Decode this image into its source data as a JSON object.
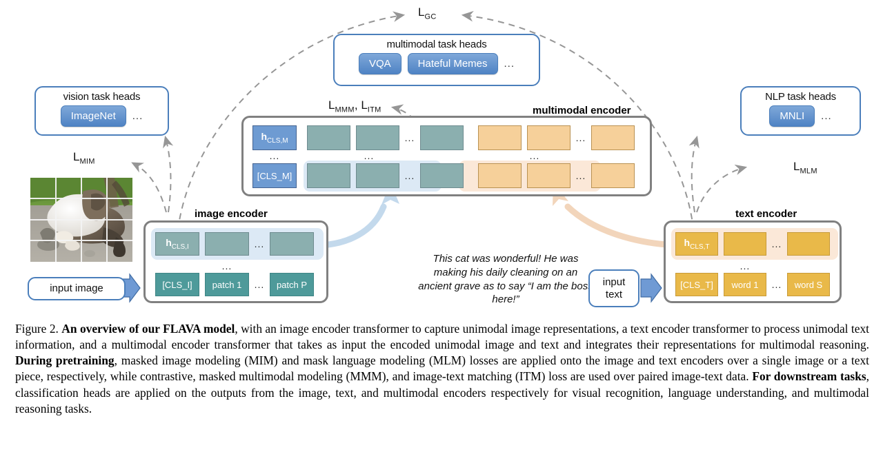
{
  "figure": {
    "losses": {
      "global_contrastive": "L",
      "global_contrastive_sub": "GC",
      "mim": "L",
      "mim_sub": "MIM",
      "mlm": "L",
      "mlm_sub": "MLM",
      "mmm_itm": "L",
      "mmm_itm_sub": "MMM",
      "mmm_itm_2": "L",
      "mmm_itm_2_sub": "ITM",
      "mmm_itm_separator": ", "
    },
    "vision_task_heads": {
      "title": "vision task heads",
      "items": [
        "ImageNet"
      ],
      "ellipsis": "..."
    },
    "multimodal_task_heads": {
      "title": "multimodal task heads",
      "items": [
        "VQA",
        "Hateful Memes"
      ],
      "ellipsis": "..."
    },
    "nlp_task_heads": {
      "title": "NLP task heads",
      "items": [
        "MNLI"
      ],
      "ellipsis": "..."
    },
    "multimodal_encoder": {
      "label": "multimodal encoder",
      "hidden_row": {
        "cls": "h",
        "cls_sub": "CLS,M",
        "image_tokens": [
          "",
          "",
          ""
        ],
        "image_ellipsis": "...",
        "text_tokens": [
          "",
          "",
          ""
        ],
        "text_ellipsis": "..."
      },
      "vertical_ellipsis": "...",
      "input_row": {
        "cls": "[CLS_M]",
        "image_tokens": [
          "",
          "",
          ""
        ],
        "image_ellipsis": "...",
        "text_tokens": [
          "",
          "",
          ""
        ],
        "text_ellipsis": "..."
      }
    },
    "image_encoder": {
      "label": "image encoder",
      "hidden_row": {
        "cls": "h",
        "cls_sub": "CLS,I",
        "tokens": [
          "",
          ""
        ],
        "ellipsis": "..."
      },
      "vertical_ellipsis": "...",
      "input_row": {
        "cls": "[CLS_I]",
        "tokens": [
          "patch 1",
          "patch P"
        ],
        "ellipsis": "..."
      }
    },
    "text_encoder": {
      "label": "text encoder",
      "hidden_row": {
        "cls": "h",
        "cls_sub": "CLS,T",
        "tokens": [
          "",
          ""
        ],
        "ellipsis": "..."
      },
      "vertical_ellipsis": "...",
      "input_row": {
        "cls": "[CLS_T]",
        "tokens": [
          "word 1",
          "word S"
        ],
        "ellipsis": "..."
      }
    },
    "input_image_label": "input image",
    "input_text_label": "input\ntext",
    "sample_caption": "This cat was wonderful! He was making his daily cleaning on an ancient grave as to say “I am the boss here!”",
    "image_alt": "photo of a white and brown tabby cat lying on gravel, divided into a 4 by 4 patch grid"
  },
  "caption": {
    "figure_number": "Figure 2.",
    "bold_1": "An overview of our FLAVA model",
    "text_1": ", with an image encoder transformer to capture unimodal image representations, a text encoder transformer to process unimodal text information, and a multimodal encoder transformer that takes as input the encoded unimodal image and text and integrates their representations for multimodal reasoning. ",
    "bold_2": "During pretraining",
    "text_2": ", masked image modeling (MIM) and mask language modeling (MLM) losses are applied onto the image and text encoders over a single image or a text piece, respectively, while contrastive, masked multimodal modeling (MMM), and image-text matching (ITM) loss are used over paired image-text data. ",
    "bold_3": "For downstream tasks",
    "text_3": ", classification heads are applied on the outputs from the image, text, and multimodal encoders respectively for visual recognition, language understanding, and multimodal reasoning tasks."
  },
  "colors": {
    "blue_accent": "#4a7ebb",
    "pill_blue": "#4f83c4",
    "teal_token": "#8bafaf",
    "teal_token_dark": "#4e9a9a",
    "orange_token": "#f6d09a",
    "orange_token_dark": "#e9b949",
    "cls_blue": "#6e9bd2",
    "encoder_border": "#808080",
    "dashed_arrow": "#969696",
    "blue_arrow": "#c3d9ec",
    "orange_arrow": "#f2d5bb"
  }
}
